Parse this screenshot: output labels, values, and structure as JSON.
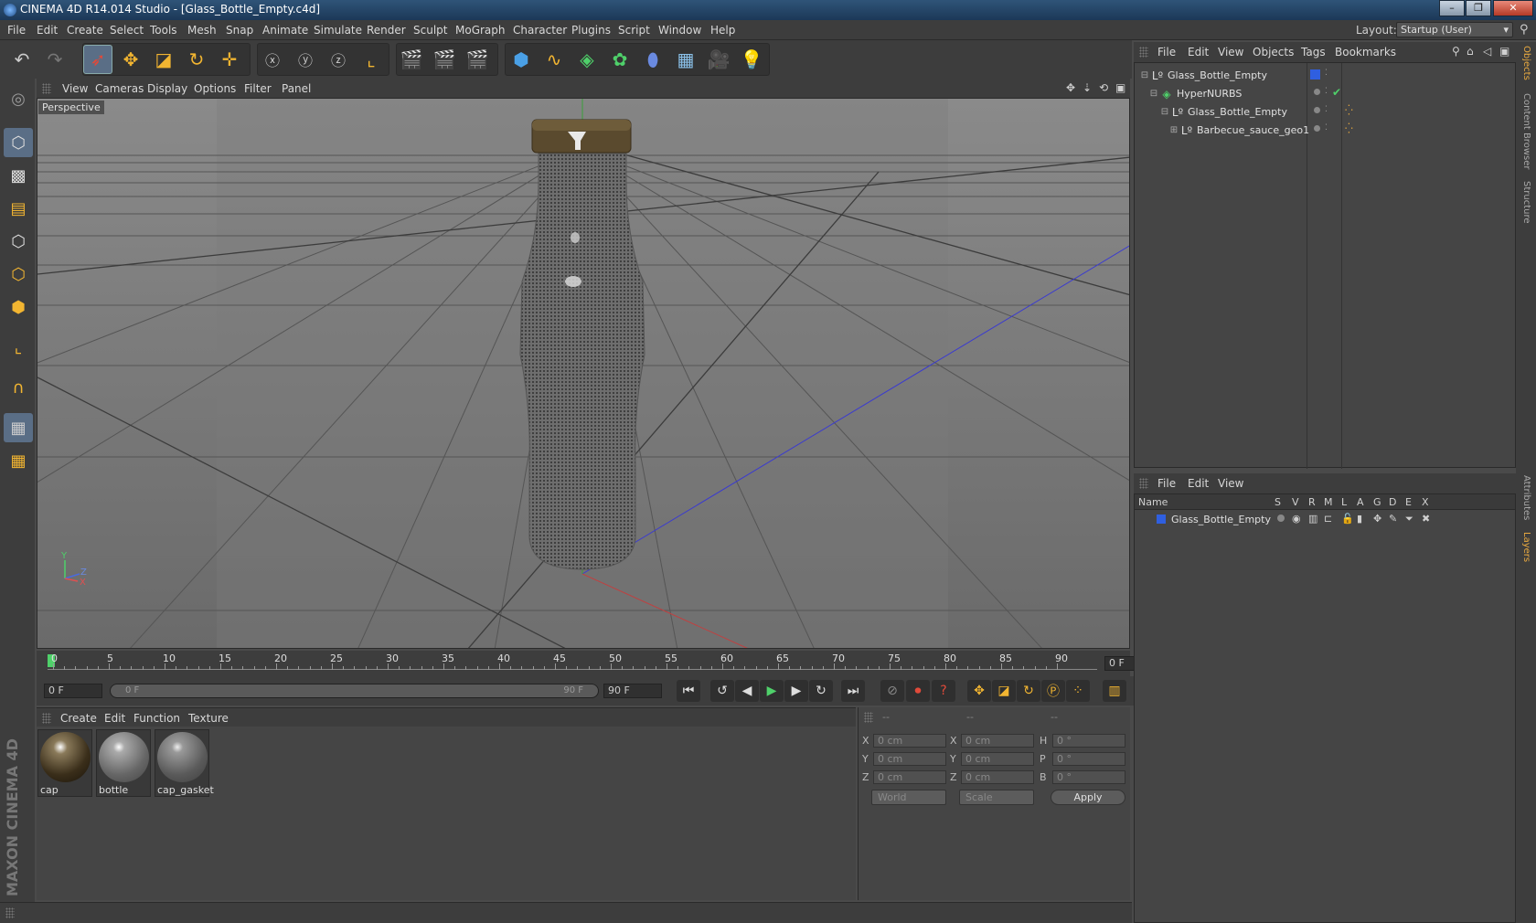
{
  "window": {
    "title": "CINEMA 4D R14.014 Studio - [Glass_Bottle_Empty.c4d]",
    "minimize": "–",
    "restore": "❐",
    "close": "✕"
  },
  "menubar": {
    "items": [
      "File",
      "Edit",
      "Create",
      "Select",
      "Tools",
      "Mesh",
      "Snap",
      "Animate",
      "Simulate",
      "Render",
      "Sculpt",
      "MoGraph",
      "Character",
      "Plugins",
      "Script",
      "Window",
      "Help"
    ],
    "layout_label": "Layout:",
    "layout_value": "Startup (User)"
  },
  "viewport": {
    "menu": [
      "View",
      "Cameras",
      "Display",
      "Options",
      "Filter",
      "Panel"
    ],
    "label": "Perspective",
    "axis_y": "Y",
    "axis_z": "Z",
    "axis_x": "X"
  },
  "timeline": {
    "ticks": [
      "0",
      "5",
      "10",
      "15",
      "20",
      "25",
      "30",
      "35",
      "40",
      "45",
      "50",
      "55",
      "60",
      "65",
      "70",
      "75",
      "80",
      "85",
      "90"
    ],
    "current_frame": "0 F"
  },
  "playbar": {
    "start_field": "0 F",
    "range_start": "0 F",
    "range_end": "90 F",
    "end_field": "90 F"
  },
  "materials": {
    "menu": [
      "Create",
      "Edit",
      "Function",
      "Texture"
    ],
    "items": [
      {
        "name": "cap",
        "color": "#6a5a3a"
      },
      {
        "name": "bottle",
        "color": "#8a8a8a"
      },
      {
        "name": "cap_gasket",
        "color": "#7a7a7a"
      }
    ]
  },
  "coordinates": {
    "headers": [
      "--",
      "--",
      "--"
    ],
    "rows": [
      {
        "a": "X",
        "av": "0 cm",
        "b": "X",
        "bv": "0 cm",
        "c": "H",
        "cv": "0 °"
      },
      {
        "a": "Y",
        "av": "0 cm",
        "b": "Y",
        "bv": "0 cm",
        "c": "P",
        "cv": "0 °"
      },
      {
        "a": "Z",
        "av": "0 cm",
        "b": "Z",
        "bv": "0 cm",
        "c": "B",
        "cv": "0 °"
      }
    ],
    "space": "World",
    "mode": "Scale",
    "apply": "Apply"
  },
  "objects": {
    "menu": [
      "File",
      "Edit",
      "View",
      "Objects",
      "Tags",
      "Bookmarks"
    ],
    "tree": [
      {
        "name": "Glass_Bottle_Empty",
        "icon": "null-icon"
      },
      {
        "name": "HyperNURBS",
        "icon": "hypernurbs-icon"
      },
      {
        "name": "Glass_Bottle_Empty",
        "icon": "null-icon"
      },
      {
        "name": "Barbecue_sauce_geo1",
        "icon": "null-icon"
      }
    ]
  },
  "layers": {
    "menu": [
      "File",
      "Edit",
      "View"
    ],
    "columns": [
      "Name",
      "S",
      "V",
      "R",
      "M",
      "L",
      "A",
      "G",
      "D",
      "E",
      "X"
    ],
    "rows": [
      {
        "name": "Glass_Bottle_Empty",
        "color": "#2f5fe0"
      }
    ]
  },
  "sidetabs": [
    "Objects",
    "Content Browser",
    "Structure",
    "Attributes",
    "Layers"
  ],
  "branding": "MAXON CINEMA 4D",
  "colors": {
    "accent": "#5a6e86",
    "layer_blue": "#2f5fe0",
    "check_green": "#4fd06a",
    "tag_orange": "#e8a940"
  }
}
